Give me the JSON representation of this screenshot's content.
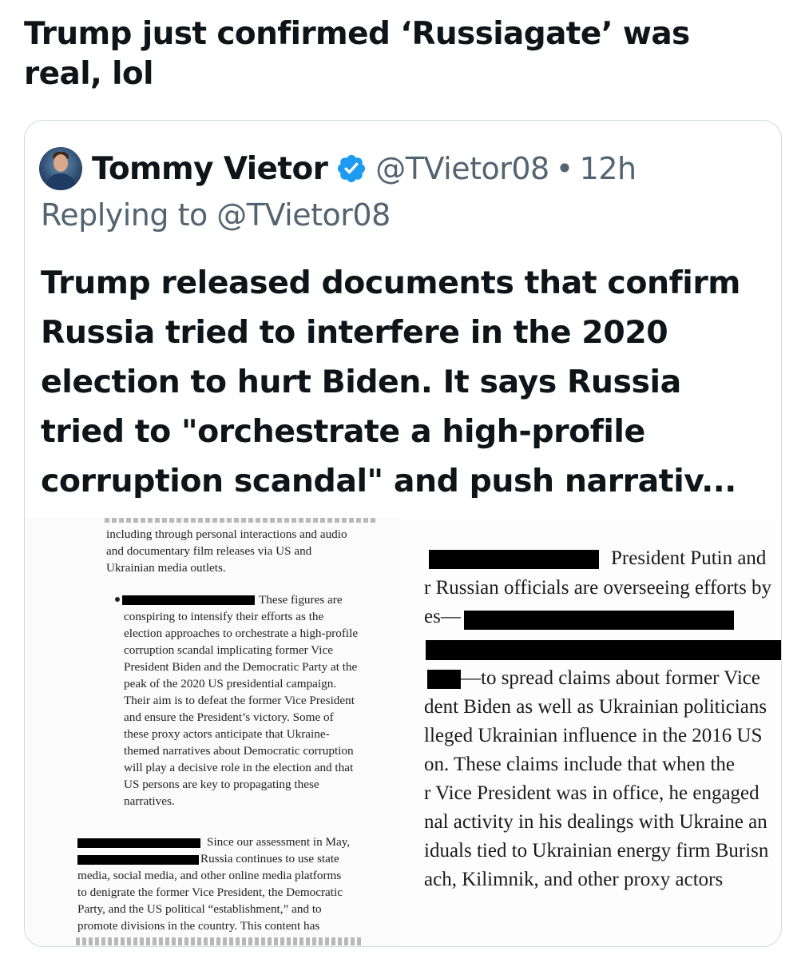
{
  "post": {
    "text_line1": "Trump just confirmed ‘Russiagate’ was",
    "text_line2": "real, lol"
  },
  "quote": {
    "author": {
      "display_name": "Tommy Vietor",
      "handle": "@TVietor08",
      "separator": "•",
      "time": "12h",
      "verified_icon": "verified-badge-icon",
      "avatar_icon": "profile-photo"
    },
    "replying_to": "Replying to @TVietor08",
    "text_lines": [
      "Trump released documents that confirm",
      "Russia tried to interfere in the 2020",
      "election to hurt Biden. It says Russia",
      "tried to \"orchestrate a high-profile",
      "corruption scandal\" and push narrativ..."
    ]
  },
  "document_left": {
    "lines": [
      "including through personal interactions and audio",
      "and documentary film releases via US and",
      "Ukrainian media outlets.",
      "These figures are",
      "conspiring to intensify their efforts as the",
      "election approaches to orchestrate a high-profile",
      "corruption scandal implicating former Vice",
      "President Biden and the Democratic Party at the",
      "peak of the 2020 US presidential campaign.",
      "Their aim is to defeat the former Vice President",
      "and ensure the President’s victory.  Some of",
      "these proxy actors anticipate that Ukraine-",
      "themed narratives about Democratic corruption",
      "will play a decisive role in the election and that",
      "US persons are key to propagating these",
      "narratives.",
      "Since our assessment in May,",
      "Russia continues to use state",
      "media, social media, and other online media platforms",
      "to denigrate the former Vice President, the Democratic",
      "Party, and the US political “establishment,” and to",
      "promote divisions in the country.  This content has"
    ]
  },
  "document_right": {
    "lines": [
      "President Putin and",
      "r Russian officials are overseeing efforts by",
      "es—",
      "—to spread claims about former Vice",
      "dent Biden as well as Ukrainian politicians",
      "lleged Ukrainian influence in the 2016 US",
      "on.  These claims include that when the",
      "r Vice President was in office, he engaged",
      "nal activity in his dealings with Ukraine an",
      "iduals tied to Ukrainian energy firm Burisn",
      "ach, Kilimnik, and other proxy actors"
    ]
  },
  "colors": {
    "text_primary": "#0f1419",
    "text_secondary": "#536471",
    "card_border": "#cfd9de",
    "verified_blue": "#1d9bf0",
    "redaction": "#000000"
  }
}
